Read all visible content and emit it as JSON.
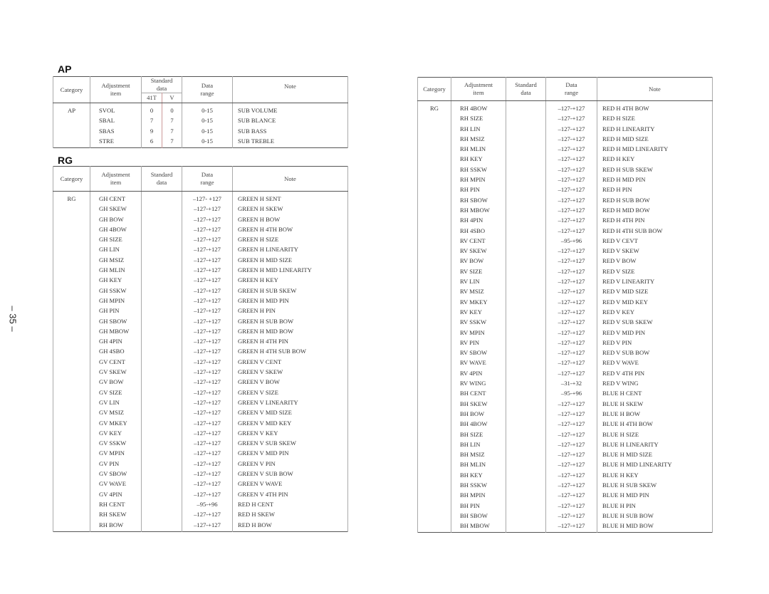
{
  "page_number": "– 35 –",
  "ap_section": {
    "title": "AP",
    "headers": {
      "category": "Category",
      "adjustment_1": "Adjustment",
      "adjustment_2": "item",
      "standard_1": "Standard",
      "standard_2": "data",
      "standard_sub_41t": "41T",
      "standard_sub_v": "V",
      "range_1": "Data",
      "range_2": "range",
      "note": "Note"
    },
    "rows": [
      {
        "category": "AP",
        "item": "SVOL",
        "std_41t": "0",
        "std_v": "0",
        "range": "0-15",
        "note": "SUB VOLUME"
      },
      {
        "category": "",
        "item": "SBAL",
        "std_41t": "7",
        "std_v": "7",
        "range": "0-15",
        "note": "SUB BLANCE"
      },
      {
        "category": "",
        "item": "SBAS",
        "std_41t": "9",
        "std_v": "7",
        "range": "0-15",
        "note": "SUB BASS"
      },
      {
        "category": "",
        "item": "STRE",
        "std_41t": "6",
        "std_v": "7",
        "range": "0-15",
        "note": "SUB TREBLE"
      }
    ]
  },
  "rg_section": {
    "title": "RG",
    "headers": {
      "category": "Category",
      "adjustment_1": "Adjustment",
      "adjustment_2": "item",
      "standard_1": "Standard",
      "standard_2": "data",
      "range_1": "Data",
      "range_2": "range",
      "note": "Note"
    },
    "rows": [
      {
        "category": "RG",
        "item": "GH CENT",
        "std": "",
        "range": "–127- +127",
        "note": "GREEN H SENT"
      },
      {
        "category": "",
        "item": "GH SKEW",
        "std": "",
        "range": "–127-+127",
        "note": "GREEN H SKEW"
      },
      {
        "category": "",
        "item": "GH BOW",
        "std": "",
        "range": "–127-+127",
        "note": "GREEN H BOW"
      },
      {
        "category": "",
        "item": "GH 4BOW",
        "std": "",
        "range": "–127-+127",
        "note": "GREEN H 4TH BOW"
      },
      {
        "category": "",
        "item": "GH SIZE",
        "std": "",
        "range": "–127-+127",
        "note": "GREEN H SIZE"
      },
      {
        "category": "",
        "item": "GH LIN",
        "std": "",
        "range": "–127-+127",
        "note": "GREEN H LINEARITY"
      },
      {
        "category": "",
        "item": "GH MSIZ",
        "std": "",
        "range": "–127-+127",
        "note": "GREEN H MID SIZE"
      },
      {
        "category": "",
        "item": "GH MLIN",
        "std": "",
        "range": "–127-+127",
        "note": "GREEN H MID LINEARITY"
      },
      {
        "category": "",
        "item": "GH KEY",
        "std": "",
        "range": "–127-+127",
        "note": "GREEN H KEY"
      },
      {
        "category": "",
        "item": "GH SSKW",
        "std": "",
        "range": "–127-+127",
        "note": "GREEN H SUB SKEW"
      },
      {
        "category": "",
        "item": "GH MPIN",
        "std": "",
        "range": "–127-+127",
        "note": "GREEN H MID PIN"
      },
      {
        "category": "",
        "item": "GH PIN",
        "std": "",
        "range": "–127-+127",
        "note": "GREEN H PIN"
      },
      {
        "category": "",
        "item": "GH SBOW",
        "std": "",
        "range": "–127-+127",
        "note": "GREEN H SUB BOW"
      },
      {
        "category": "",
        "item": "GH MBOW",
        "std": "",
        "range": "–127-+127",
        "note": "GREEN H MID BOW"
      },
      {
        "category": "",
        "item": "GH 4PIN",
        "std": "",
        "range": "–127-+127",
        "note": "GREEN H 4TH PIN"
      },
      {
        "category": "",
        "item": "GH 4SBO",
        "std": "",
        "range": "–127-+127",
        "note": "GREEN H 4TH SUB BOW"
      },
      {
        "category": "",
        "item": "GV CENT",
        "std": "",
        "range": "–127-+127",
        "note": "GREEN V CENT"
      },
      {
        "category": "",
        "item": "GV SKEW",
        "std": "",
        "range": "–127-+127",
        "note": "GREEN V SKEW"
      },
      {
        "category": "",
        "item": "GV BOW",
        "std": "",
        "range": "–127-+127",
        "note": "GREEN V BOW"
      },
      {
        "category": "",
        "item": "GV SIZE",
        "std": "",
        "range": "–127-+127",
        "note": "GREEN V SIZE"
      },
      {
        "category": "",
        "item": "GV LIN",
        "std": "",
        "range": "–127-+127",
        "note": "GREEN V LINEARITY"
      },
      {
        "category": "",
        "item": "GV MSIZ",
        "std": "",
        "range": "–127-+127",
        "note": "GREEN V MID SIZE"
      },
      {
        "category": "",
        "item": "GV MKEY",
        "std": "",
        "range": "–127-+127",
        "note": "GREEN V MID KEY"
      },
      {
        "category": "",
        "item": "GV KEY",
        "std": "",
        "range": "–127-+127",
        "note": "GREEN V KEY"
      },
      {
        "category": "",
        "item": "GV SSKW",
        "std": "",
        "range": "–127-+127",
        "note": "GREEN V SUB SKEW"
      },
      {
        "category": "",
        "item": "GV MPIN",
        "std": "",
        "range": "–127-+127",
        "note": "GREEN V MID PIN"
      },
      {
        "category": "",
        "item": "GV PIN",
        "std": "",
        "range": "–127-+127",
        "note": "GREEN V PIN"
      },
      {
        "category": "",
        "item": "GV SBOW",
        "std": "",
        "range": "–127-+127",
        "note": "GREEN V SUB BOW"
      },
      {
        "category": "",
        "item": "GV WAVE",
        "std": "",
        "range": "–127-+127",
        "note": "GREEN V WAVE"
      },
      {
        "category": "",
        "item": "GV 4PIN",
        "std": "",
        "range": "–127-+127",
        "note": "GREEN V 4TH PIN"
      },
      {
        "category": "",
        "item": "RH CENT",
        "std": "",
        "range": "–95-+96",
        "note": "RED H CENT"
      },
      {
        "category": "",
        "item": "RH SKEW",
        "std": "",
        "range": "–127-+127",
        "note": "RED H SKEW"
      },
      {
        "category": "",
        "item": "RH BOW",
        "std": "",
        "range": "–127-+127",
        "note": "RED H BOW"
      }
    ]
  },
  "rg_continued": {
    "headers": {
      "category": "Category",
      "adjustment_1": "Adjustment",
      "adjustment_2": "item",
      "standard_1": "Standard",
      "standard_2": "data",
      "range_1": "Data",
      "range_2": "range",
      "note": "Note"
    },
    "rows": [
      {
        "category": "RG",
        "item": "RH 4BOW",
        "std": "",
        "range": "–127-+127",
        "note": "RED H 4TH BOW"
      },
      {
        "category": "",
        "item": "RH SIZE",
        "std": "",
        "range": "–127-+127",
        "note": "RED H SIZE"
      },
      {
        "category": "",
        "item": "RH LIN",
        "std": "",
        "range": "–127-+127",
        "note": "RED H LINEARITY"
      },
      {
        "category": "",
        "item": "RH MSIZ",
        "std": "",
        "range": "–127-+127",
        "note": "RED H MID SIZE"
      },
      {
        "category": "",
        "item": "RH MLIN",
        "std": "",
        "range": "–127-+127",
        "note": "RED H MID LINEARITY"
      },
      {
        "category": "",
        "item": "RH KEY",
        "std": "",
        "range": "–127-+127",
        "note": "RED H KEY"
      },
      {
        "category": "",
        "item": "RH SSKW",
        "std": "",
        "range": "–127-+127",
        "note": "RED H SUB SKEW"
      },
      {
        "category": "",
        "item": "RH MPIN",
        "std": "",
        "range": "–127-+127",
        "note": "RED H MID PIN"
      },
      {
        "category": "",
        "item": "RH PIN",
        "std": "",
        "range": "–127-+127",
        "note": "RED H PIN"
      },
      {
        "category": "",
        "item": "RH SBOW",
        "std": "",
        "range": "–127-+127",
        "note": "RED H SUB BOW"
      },
      {
        "category": "",
        "item": "RH MBOW",
        "std": "",
        "range": "–127-+127",
        "note": "RED H MID BOW"
      },
      {
        "category": "",
        "item": "RH 4PIN",
        "std": "",
        "range": "–127-+127",
        "note": "RED H 4TH PIN"
      },
      {
        "category": "",
        "item": "RH 4SBO",
        "std": "",
        "range": "–127-+127",
        "note": "RED H 4TH SUB BOW"
      },
      {
        "category": "",
        "item": "RV CENT",
        "std": "",
        "range": "–95-+96",
        "note": "RED V CEVT"
      },
      {
        "category": "",
        "item": "RV SKEW",
        "std": "",
        "range": "–127-+127",
        "note": "RED V SKEW"
      },
      {
        "category": "",
        "item": "RV BOW",
        "std": "",
        "range": "–127-+127",
        "note": "RED V BOW"
      },
      {
        "category": "",
        "item": "RV SIZE",
        "std": "",
        "range": "–127-+127",
        "note": "RED V SIZE"
      },
      {
        "category": "",
        "item": "RV LIN",
        "std": "",
        "range": "–127-+127",
        "note": "RED V LINEARITY"
      },
      {
        "category": "",
        "item": "RV MSIZ",
        "std": "",
        "range": "–127-+127",
        "note": "RED V MID SIZE"
      },
      {
        "category": "",
        "item": "RV MKEY",
        "std": "",
        "range": "–127-+127",
        "note": "RED V MID KEY"
      },
      {
        "category": "",
        "item": "RV KEY",
        "std": "",
        "range": "–127-+127",
        "note": "RED V KEY"
      },
      {
        "category": "",
        "item": "RV SSKW",
        "std": "",
        "range": "–127-+127",
        "note": "RED V SUB SKEW"
      },
      {
        "category": "",
        "item": "RV MPIN",
        "std": "",
        "range": "–127-+127",
        "note": "RED V MID PIN"
      },
      {
        "category": "",
        "item": "RV PIN",
        "std": "",
        "range": "–127-+127",
        "note": "RED V PIN"
      },
      {
        "category": "",
        "item": "RV SBOW",
        "std": "",
        "range": "–127-+127",
        "note": "RED V SUB BOW"
      },
      {
        "category": "",
        "item": "RV WAVE",
        "std": "",
        "range": "–127-+127",
        "note": "RED V WAVE"
      },
      {
        "category": "",
        "item": "RV 4PIN",
        "std": "",
        "range": "–127-+127",
        "note": "RED V 4TH PIN"
      },
      {
        "category": "",
        "item": "RV WING",
        "std": "",
        "range": "–31-+32",
        "note": "RED V WING"
      },
      {
        "category": "",
        "item": "BH CENT",
        "std": "",
        "range": "–95-+96",
        "note": "BLUE H CENT"
      },
      {
        "category": "",
        "item": "BH SKEW",
        "std": "",
        "range": "–127-+127",
        "note": "BLUE H SKEW"
      },
      {
        "category": "",
        "item": "BH BOW",
        "std": "",
        "range": "–127-+127",
        "note": "BLUE H BOW"
      },
      {
        "category": "",
        "item": "BH 4BOW",
        "std": "",
        "range": "–127-+127",
        "note": "BLUE H 4TH BOW"
      },
      {
        "category": "",
        "item": "BH SIZE",
        "std": "",
        "range": "–127-+127",
        "note": "BLUE H SIZE"
      },
      {
        "category": "",
        "item": "BH LIN",
        "std": "",
        "range": "–127-+127",
        "note": "BLUE H LINEARITY"
      },
      {
        "category": "",
        "item": "BH MSIZ",
        "std": "",
        "range": "–127-+127",
        "note": "BLUE H MID SIZE"
      },
      {
        "category": "",
        "item": "BH MLIN",
        "std": "",
        "range": "–127-+127",
        "note": "BLUE H MID LINEARITY"
      },
      {
        "category": "",
        "item": "BH KEY",
        "std": "",
        "range": "–127-+127",
        "note": "BLUE H KEY"
      },
      {
        "category": "",
        "item": "BH SSKW",
        "std": "",
        "range": "–127-+127",
        "note": "BLUE H SUB SKEW"
      },
      {
        "category": "",
        "item": "BH MPIN",
        "std": "",
        "range": "–127-+127",
        "note": "BLUE H MID PIN"
      },
      {
        "category": "",
        "item": "BH PIN",
        "std": "",
        "range": "–127-+127",
        "note": "BLUE H PIN"
      },
      {
        "category": "",
        "item": "BH SBOW",
        "std": "",
        "range": "–127-+127",
        "note": "BLUE H SUB BOW"
      },
      {
        "category": "",
        "item": "BH MBOW",
        "std": "",
        "range": "–127-+127",
        "note": "BLUE H MID BOW"
      }
    ]
  }
}
